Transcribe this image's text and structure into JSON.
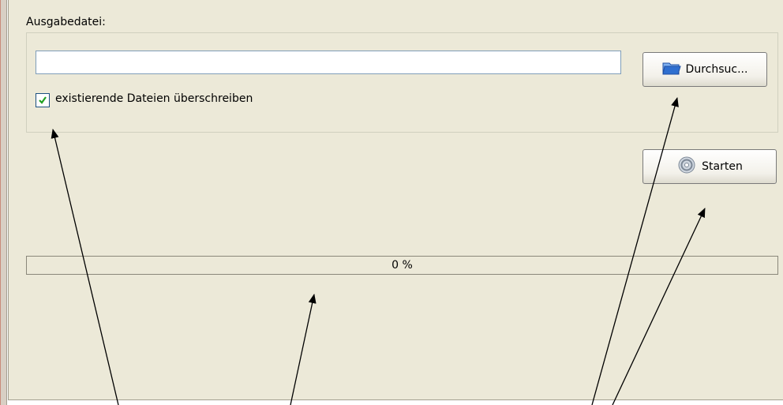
{
  "output_group": {
    "label": "Ausgabedatei:",
    "file_path_value": "",
    "overwrite_checkbox": {
      "label": "existierende Dateien überschreiben",
      "checked": true
    }
  },
  "buttons": {
    "browse_label": "Durchsuc...",
    "start_label": "Starten"
  },
  "progress": {
    "value_percent": 0,
    "label": "0 %"
  },
  "colors": {
    "panel_background": "#ece9d8",
    "check_color": "#21a121",
    "folder_icon": "#2f6fd0",
    "progress_fill": "#3c9b3c"
  },
  "icons": {
    "browse": "folder-icon",
    "start": "gear-icon",
    "checkbox": "checkmark-icon"
  }
}
